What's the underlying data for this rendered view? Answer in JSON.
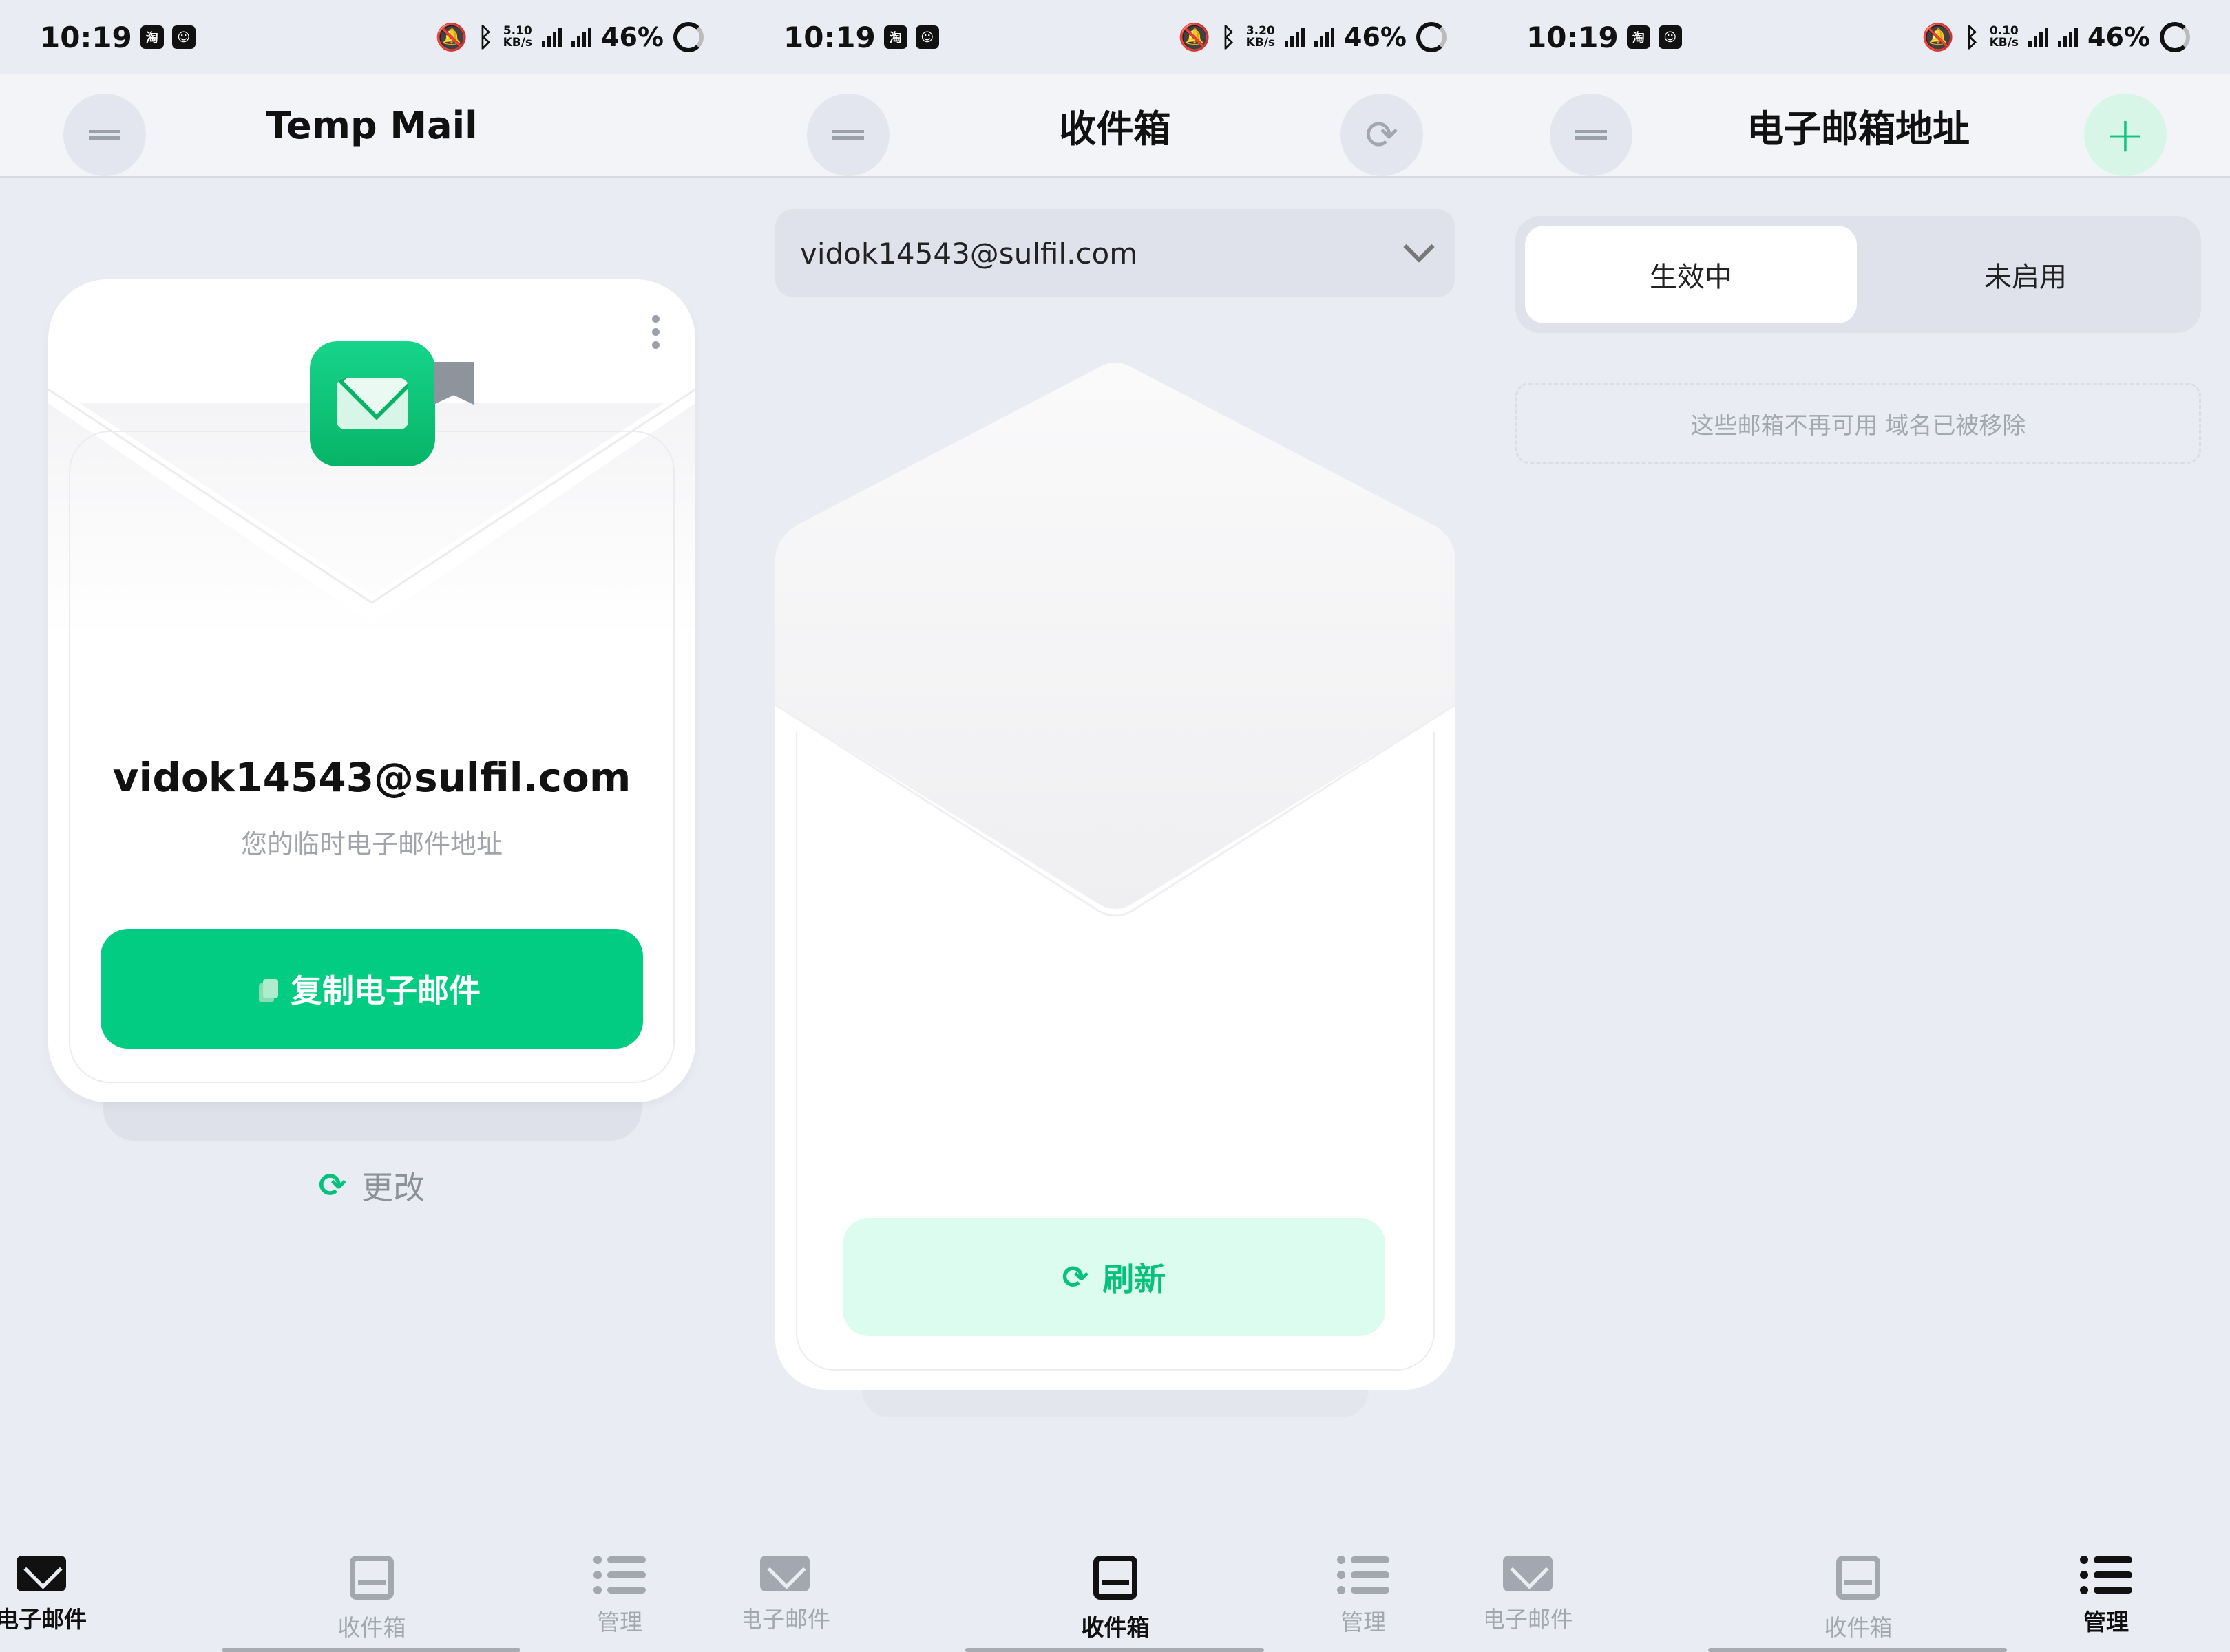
{
  "status": {
    "s1": {
      "time": "10:19",
      "speed_top": "5.10",
      "speed_unit": "KB/s",
      "battery": "46%"
    },
    "s2": {
      "time": "10:19",
      "speed_top": "3.20",
      "speed_unit": "KB/s",
      "battery": "46%"
    },
    "s3": {
      "time": "10:19",
      "speed_top": "0.10",
      "speed_unit": "KB/s",
      "battery": "46%"
    },
    "icon_a": "淘",
    "icon_b": "☺"
  },
  "screen1": {
    "title": "Temp Mail",
    "email": "vidok14543@sulfil.com",
    "subtitle": "您的临时电子邮件地址",
    "copy_label": "复制电子邮件",
    "change_label": "更改"
  },
  "screen2": {
    "title": "收件箱",
    "selected_email": "vidok14543@sulfil.com",
    "refresh_label": "刷新"
  },
  "screen3": {
    "title": "电子邮箱地址",
    "tabs": [
      {
        "label": "生效中"
      },
      {
        "label": "未启用"
      }
    ],
    "notice": "这些邮箱不再可用 域名已被移除"
  },
  "nav": {
    "items": [
      {
        "label": "电子邮件"
      },
      {
        "label": "收件箱"
      },
      {
        "label": "管理"
      }
    ]
  },
  "colors": {
    "accent": "#01cc82",
    "accent_light": "#dcfcf0",
    "background": "#e9ecf3"
  }
}
